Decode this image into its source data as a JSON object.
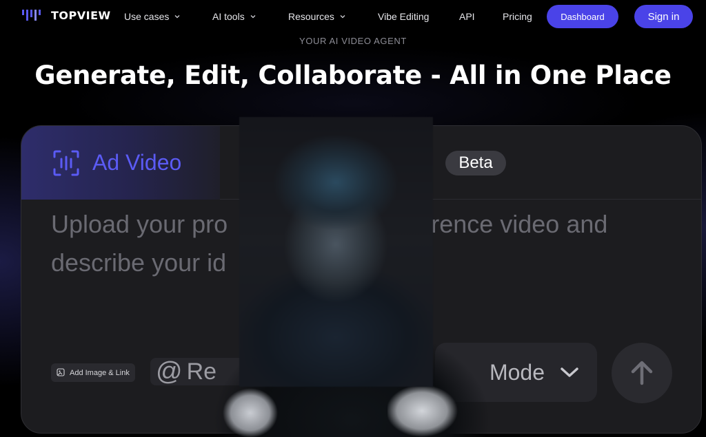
{
  "brand": {
    "name": "TOPVIEW",
    "accent": "#4a43e8"
  },
  "nav": {
    "items": [
      {
        "label": "Use cases",
        "has_dropdown": true
      },
      {
        "label": "AI tools",
        "has_dropdown": true
      },
      {
        "label": "Resources",
        "has_dropdown": true
      },
      {
        "label": "Vibe Editing",
        "has_dropdown": false
      },
      {
        "label": "API",
        "has_dropdown": false
      },
      {
        "label": "Pricing",
        "has_dropdown": false
      }
    ],
    "dashboard_label": "Dashboard",
    "signin_label": "Sign in"
  },
  "hero": {
    "eyebrow": "YOUR AI VIDEO AGENT",
    "headline": "Generate, Edit, Collaborate - All in One Place"
  },
  "card": {
    "active_tab": {
      "label": "Ad Video",
      "icon": "scan-waveform-icon",
      "color": "#5b5bf5"
    },
    "beta_badge": "Beta",
    "prompt_line1": "Upload your pro",
    "prompt_line1_end": "eference video and",
    "prompt_line2": "describe your id",
    "add_image_label": "Add Image & Link",
    "reference_chip_label": "Re",
    "mode_label": "Mode",
    "send_icon": "arrow-up-icon"
  }
}
